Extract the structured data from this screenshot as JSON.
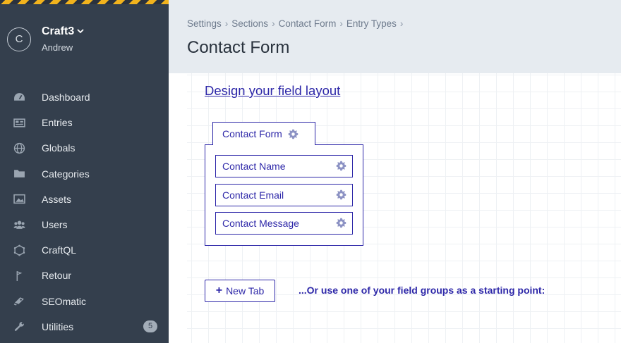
{
  "site": {
    "logo_letter": "C",
    "name": "Craft3",
    "user": "Andrew"
  },
  "nav": [
    {
      "label": "Dashboard",
      "icon": "gauge-icon"
    },
    {
      "label": "Entries",
      "icon": "newspaper-icon"
    },
    {
      "label": "Globals",
      "icon": "globe-icon"
    },
    {
      "label": "Categories",
      "icon": "folder-icon"
    },
    {
      "label": "Assets",
      "icon": "image-icon"
    },
    {
      "label": "Users",
      "icon": "users-icon"
    },
    {
      "label": "CraftQL",
      "icon": "craftql-icon"
    },
    {
      "label": "Retour",
      "icon": "flag-icon"
    },
    {
      "label": "SEOmatic",
      "icon": "seomatic-icon"
    },
    {
      "label": "Utilities",
      "icon": "wrench-icon",
      "badge": "5"
    }
  ],
  "breadcrumbs": [
    "Settings",
    "Sections",
    "Contact Form",
    "Entry Types"
  ],
  "page_title": "Contact Form",
  "layout": {
    "heading": "Design your field layout",
    "tab_label": "Contact Form",
    "fields": [
      "Contact Name",
      "Contact Email",
      "Contact Message"
    ],
    "new_tab_label": "New Tab",
    "hint": "...Or use one of your field groups as a starting point:"
  },
  "colors": {
    "sidebar": "#343f4d",
    "accent": "#2d27a8",
    "header": "#e6ebf0"
  }
}
